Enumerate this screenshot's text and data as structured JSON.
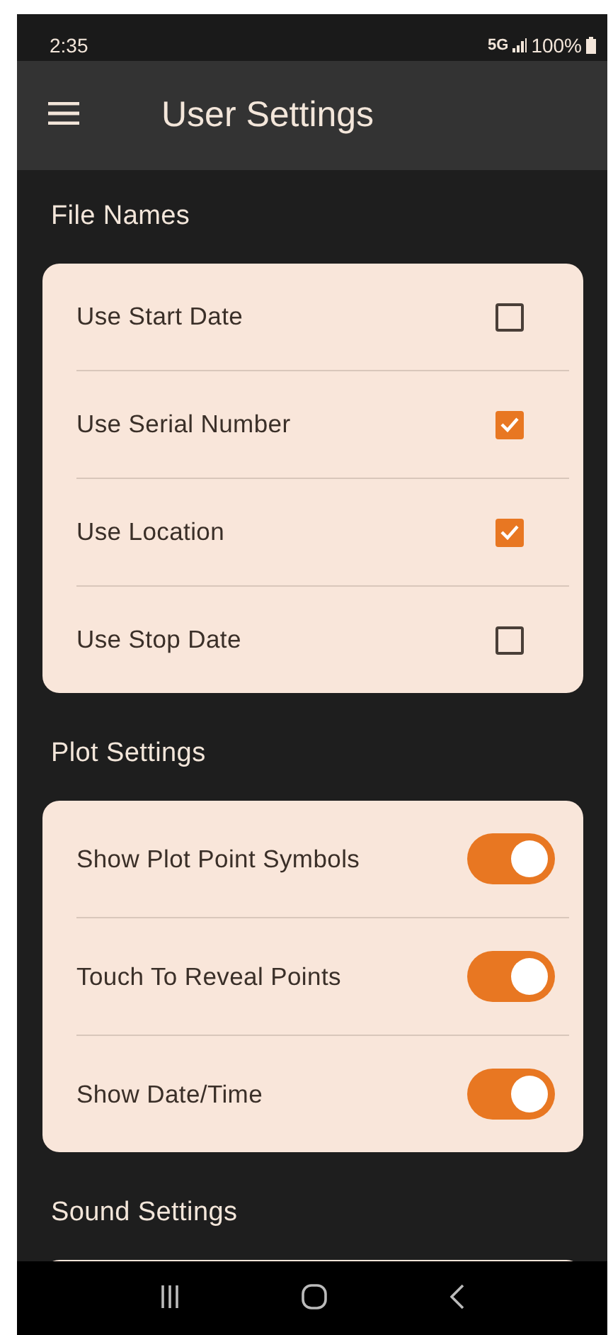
{
  "status_bar": {
    "time": "2:35",
    "network": "5G",
    "battery": "100%"
  },
  "app_bar": {
    "title": "User Settings"
  },
  "sections": [
    {
      "title": "File Names",
      "items": [
        {
          "kind": "checkbox",
          "label": "Use Start Date",
          "checked": false
        },
        {
          "kind": "checkbox",
          "label": "Use Serial Number",
          "checked": true
        },
        {
          "kind": "checkbox",
          "label": "Use Location",
          "checked": true
        },
        {
          "kind": "checkbox",
          "label": "Use Stop Date",
          "checked": false
        }
      ]
    },
    {
      "title": "Plot Settings",
      "items": [
        {
          "kind": "switch",
          "label": "Show Plot Point Symbols",
          "on": true
        },
        {
          "kind": "switch",
          "label": "Touch To Reveal Points",
          "on": true
        },
        {
          "kind": "switch",
          "label": "Show Date/Time",
          "on": true
        }
      ]
    },
    {
      "title": "Sound Settings"
    }
  ]
}
